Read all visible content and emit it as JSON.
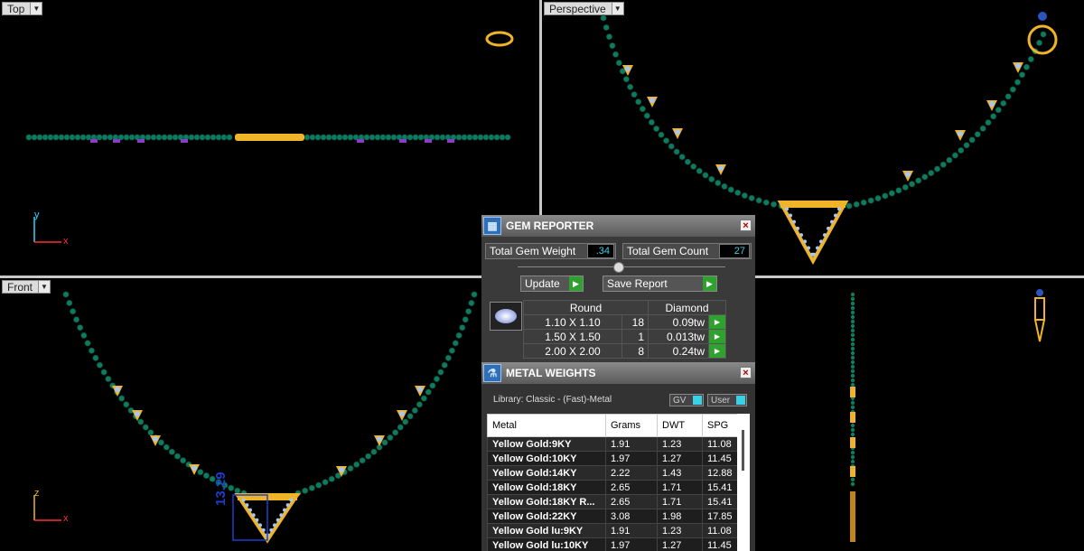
{
  "viewports": {
    "top": {
      "label": "Top",
      "axis_v": "y",
      "axis_h": "x"
    },
    "perspective": {
      "label": "Perspective",
      "axis_v": "z"
    },
    "front": {
      "label": "Front",
      "axis_v": "z",
      "axis_h": "x",
      "dimension": "13.29"
    }
  },
  "gem_reporter": {
    "title": "GEM REPORTER",
    "total_weight_label": "Total Gem Weight",
    "total_weight_value": ".34",
    "total_count_label": "Total Gem Count",
    "total_count_value": "27",
    "update_label": "Update",
    "save_label": "Save Report",
    "shape": "Round",
    "material": "Diamond",
    "rows": [
      {
        "size": "1.10 X 1.10",
        "count": "18",
        "weight": "0.09tw"
      },
      {
        "size": "1.50 X 1.50",
        "count": "1",
        "weight": "0.013tw"
      },
      {
        "size": "2.00 X 2.00",
        "count": "8",
        "weight": "0.24tw"
      }
    ]
  },
  "metal_weights": {
    "title": "METAL WEIGHTS",
    "library": "Library: Classic - (Fast)-Metal",
    "gv_label": "GV",
    "user_label": "User",
    "headers": [
      "Metal",
      "Grams",
      "DWT",
      "SPG"
    ],
    "rows": [
      [
        "Yellow Gold:9KY",
        "1.91",
        "1.23",
        "11.08"
      ],
      [
        "Yellow Gold:10KY",
        "1.97",
        "1.27",
        "11.45"
      ],
      [
        "Yellow Gold:14KY",
        "2.22",
        "1.43",
        "12.88"
      ],
      [
        "Yellow Gold:18KY",
        "2.65",
        "1.71",
        "15.41"
      ],
      [
        "Yellow Gold:18KY R...",
        "2.65",
        "1.71",
        "15.41"
      ],
      [
        "Yellow Gold:22KY",
        "3.08",
        "1.98",
        "17.85"
      ],
      [
        "Yellow Gold lu:9KY",
        "1.91",
        "1.23",
        "11.08"
      ],
      [
        "Yellow Gold lu:10KY",
        "1.97",
        "1.27",
        "11.45"
      ]
    ]
  },
  "colors": {
    "bead": "#0e7a5e",
    "gold": "#f0b429",
    "stone": "#a8c6ee"
  }
}
